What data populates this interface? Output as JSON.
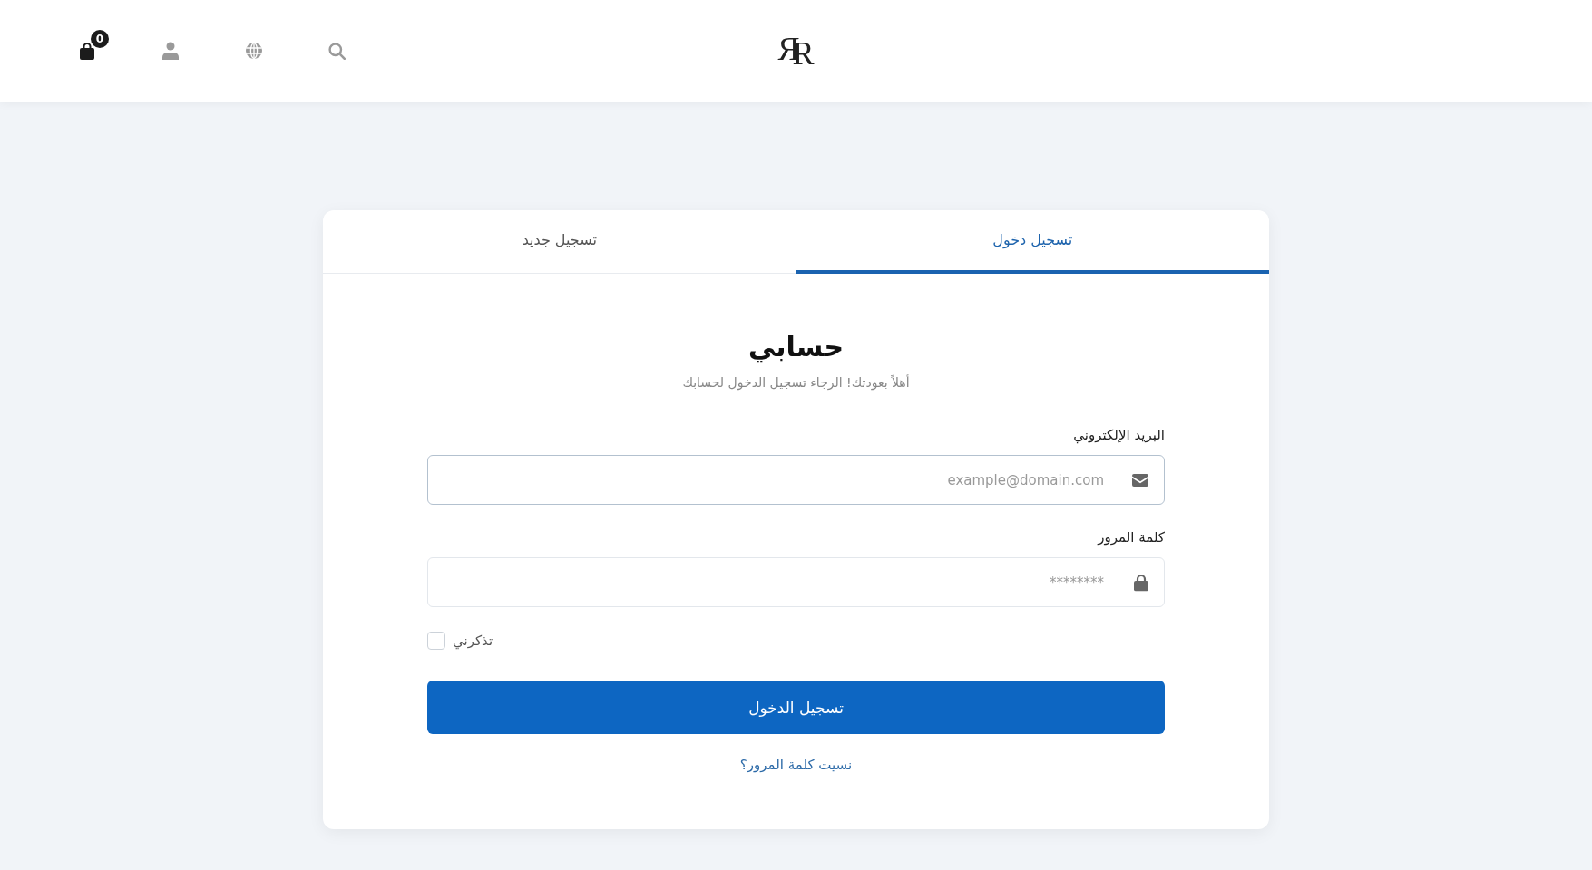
{
  "header": {
    "logo": "ЯR",
    "cart_badge": "0"
  },
  "tabs": [
    {
      "label": "تسجيل دخول",
      "selected": true
    },
    {
      "label": "تسجيل جديد",
      "selected": false
    }
  ],
  "form": {
    "title": "حسابي",
    "subtitle": "أهلاً بعودتك! الرجاء تسجيل الدخول لحسابك",
    "fields": [
      {
        "kind": "email",
        "label": "البريد الإلكتروني",
        "placeholder": "example@domain.com",
        "focused": true
      },
      {
        "kind": "password",
        "label": "كلمة المرور",
        "placeholder": "********",
        "focused": false
      }
    ],
    "remember": {
      "label": "تذكرني",
      "checked": false
    },
    "submit": "تسجيل الدخول",
    "forgot_link": "نسيت كلمة المرور؟"
  }
}
